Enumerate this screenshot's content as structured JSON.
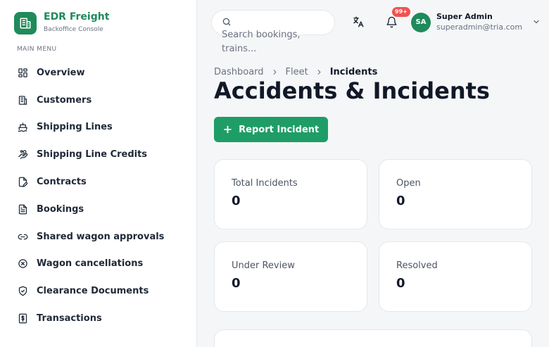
{
  "brand": {
    "name": "EDR Freight",
    "subtitle": "Backoffice Console"
  },
  "sidebar": {
    "heading": "MAIN MENU",
    "items": [
      {
        "label": "Overview",
        "icon": "dashboard-icon"
      },
      {
        "label": "Customers",
        "icon": "building-icon"
      },
      {
        "label": "Shipping Lines",
        "icon": "ship-icon"
      },
      {
        "label": "Shipping Line Credits",
        "icon": "hand-coins-icon"
      },
      {
        "label": "Contracts",
        "icon": "file-pen-icon"
      },
      {
        "label": "Bookings",
        "icon": "file-text-icon"
      },
      {
        "label": "Shared wagon approvals",
        "icon": "link-icon"
      },
      {
        "label": "Wagon cancellations",
        "icon": "circle-x-icon"
      },
      {
        "label": "Clearance Documents",
        "icon": "shield-check-icon"
      },
      {
        "label": "Transactions",
        "icon": "receipt-dollar-icon"
      }
    ]
  },
  "header": {
    "search_placeholder": "Search bookings, trains...",
    "notification_badge": "99+",
    "user": {
      "initials": "SA",
      "name": "Super Admin",
      "email": "superadmin@tria.com"
    }
  },
  "breadcrumb": [
    "Dashboard",
    "Fleet",
    "Incidents"
  ],
  "page": {
    "title": "Accidents & Incidents",
    "report_button": "Report Incident"
  },
  "stats": [
    {
      "label": "Total Incidents",
      "value": "0"
    },
    {
      "label": "Open",
      "value": "0"
    },
    {
      "label": "Under Review",
      "value": "0"
    },
    {
      "label": "Resolved",
      "value": "0"
    }
  ],
  "colors": {
    "brand": "#1f8a5b",
    "primary_button": "#1f9d67",
    "badge": "#ef5350"
  }
}
